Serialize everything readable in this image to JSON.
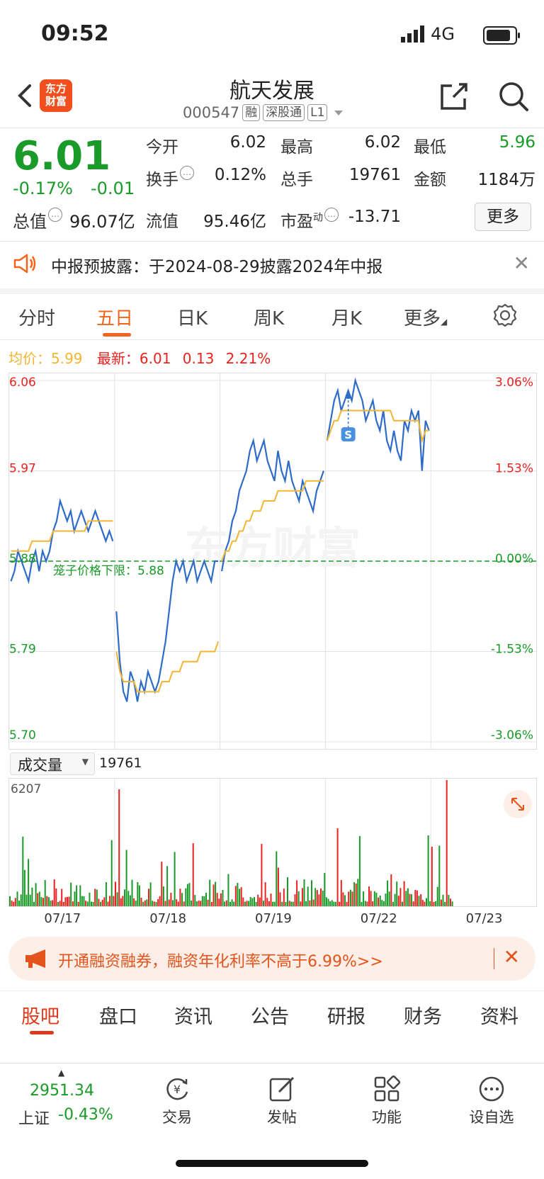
{
  "status": {
    "time": "09:52",
    "network": "4G"
  },
  "header": {
    "logo_text": "东方\n财富",
    "name": "航天发展",
    "code": "000547",
    "tags": [
      "融",
      "深股通",
      "L1"
    ]
  },
  "quote": {
    "price": "6.01",
    "change_pct": "-0.17%",
    "change": "-0.01",
    "open_label": "今开",
    "open": "6.02",
    "high_label": "最高",
    "high": "6.02",
    "low_label": "最低",
    "low": "5.96",
    "turnover_label": "换手",
    "turnover": "0.12%",
    "volume_label": "总手",
    "volume": "19761",
    "amount_label": "金额",
    "amount": "1184万",
    "mcap_label": "总值",
    "mcap": "96.07亿",
    "float_label": "流值",
    "float": "95.46亿",
    "pe_label": "市盈",
    "pe_sup": "动",
    "pe": "-13.71",
    "more_label": "更多"
  },
  "notice": {
    "text": "中报预披露：于2024-08-29披露2024年中报"
  },
  "tabs": [
    "分时",
    "五日",
    "日K",
    "周K",
    "月K",
    "更多"
  ],
  "active_tab": 1,
  "legend": {
    "avg_label": "均价：",
    "avg_value": "5.99",
    "latest_label": "最新：",
    "latest_value": "6.01",
    "latest_change": "0.13",
    "latest_pct": "2.21%"
  },
  "chart_data": {
    "type": "line",
    "x": [
      "07/17",
      "07/18",
      "07/19",
      "07/22",
      "07/23"
    ],
    "y_left_ticks": [
      "6.06",
      "5.97",
      "5.88",
      "5.79",
      "5.70"
    ],
    "y_right_ticks": [
      "3.06%",
      "1.53%",
      "0.00%",
      "-1.53%",
      "-3.06%"
    ],
    "ylim": [
      5.7,
      6.06
    ],
    "limit_label": "笼子价格下限：5.88",
    "watermark": "东方财富",
    "series": [
      {
        "values": [
          5.86,
          5.87,
          5.89,
          5.88,
          5.87,
          5.86,
          5.88,
          5.89,
          5.87,
          5.89,
          5.88,
          5.89,
          5.91,
          5.92,
          5.94,
          5.93,
          5.92,
          5.93,
          5.91,
          5.92,
          5.93,
          5.92,
          5.91,
          5.92,
          5.93,
          5.92,
          5.91,
          5.9,
          5.91,
          5.9,
          5.83,
          5.78,
          5.75,
          5.74,
          5.77,
          5.76,
          5.74,
          5.76,
          5.75,
          5.77,
          5.76,
          5.75,
          5.76,
          5.78,
          5.8,
          5.83,
          5.86,
          5.88,
          5.87,
          5.88,
          5.86,
          5.87,
          5.88,
          5.86,
          5.87,
          5.88,
          5.87,
          5.86,
          5.88,
          5.88,
          5.87,
          5.89,
          5.9,
          5.92,
          5.93,
          5.95,
          5.96,
          5.97,
          5.99,
          6.0,
          5.98,
          5.99,
          6.0,
          5.98,
          5.97,
          5.96,
          5.99,
          5.97,
          5.96,
          5.98,
          5.96,
          5.95,
          5.94,
          5.96,
          5.95,
          5.94,
          5.93,
          5.95,
          5.96,
          5.97,
          6.0,
          6.02,
          6.04,
          6.05,
          6.03,
          6.04,
          6.05,
          6.04,
          6.06,
          6.05,
          6.04,
          6.02,
          6.03,
          6.04,
          6.02,
          6.01,
          6.03,
          6.0,
          5.99,
          6.01,
          5.99,
          5.98,
          6.02,
          6.01,
          6.03,
          6.02,
          6.03,
          5.97,
          6.02,
          6.01
        ]
      },
      {
        "values": [
          5.89,
          5.89,
          5.89,
          5.89,
          5.89,
          5.89,
          5.9,
          5.9,
          5.9,
          5.9,
          5.9,
          5.9,
          5.91,
          5.91,
          5.91,
          5.91,
          5.91,
          5.91,
          5.91,
          5.91,
          5.91,
          5.91,
          5.92,
          5.92,
          5.92,
          5.92,
          5.92,
          5.92,
          5.92,
          5.92,
          5.79,
          5.77,
          5.76,
          5.76,
          5.76,
          5.76,
          5.75,
          5.75,
          5.75,
          5.75,
          5.75,
          5.75,
          5.75,
          5.76,
          5.76,
          5.76,
          5.77,
          5.77,
          5.77,
          5.78,
          5.78,
          5.78,
          5.78,
          5.78,
          5.79,
          5.79,
          5.79,
          5.79,
          5.79,
          5.8,
          5.88,
          5.89,
          5.89,
          5.9,
          5.9,
          5.91,
          5.91,
          5.92,
          5.92,
          5.93,
          5.93,
          5.93,
          5.94,
          5.94,
          5.94,
          5.94,
          5.95,
          5.95,
          5.95,
          5.95,
          5.95,
          5.95,
          5.95,
          5.95,
          5.96,
          5.96,
          5.96,
          5.96,
          5.96,
          5.96,
          6.0,
          6.01,
          6.02,
          6.02,
          6.03,
          6.03,
          6.03,
          6.03,
          6.03,
          6.03,
          6.03,
          6.03,
          6.03,
          6.03,
          6.03,
          6.03,
          6.03,
          6.03,
          6.03,
          6.02,
          6.02,
          6.02,
          6.02,
          6.02,
          6.02,
          6.02,
          6.02,
          6.0,
          6.01,
          6.01
        ]
      }
    ]
  },
  "volume": {
    "label": "成交量",
    "total": "19761",
    "max_label": "6207"
  },
  "banner": {
    "text": "开通融资融券，融资年化利率不高于6.99%>>"
  },
  "subtabs": [
    "股吧",
    "盘口",
    "资讯",
    "公告",
    "研报",
    "财务",
    "资料"
  ],
  "bottom": {
    "index_value": "2951.34",
    "index_name": "上证",
    "index_change": "-0.43%",
    "nav": [
      "交易",
      "发帖",
      "功能",
      "设自选"
    ]
  },
  "colors": {
    "up": "#e8231f",
    "down": "#1a9a28",
    "accent": "#f2631b",
    "price_line": "#2f6cc8",
    "avg_line": "#f2b632"
  }
}
